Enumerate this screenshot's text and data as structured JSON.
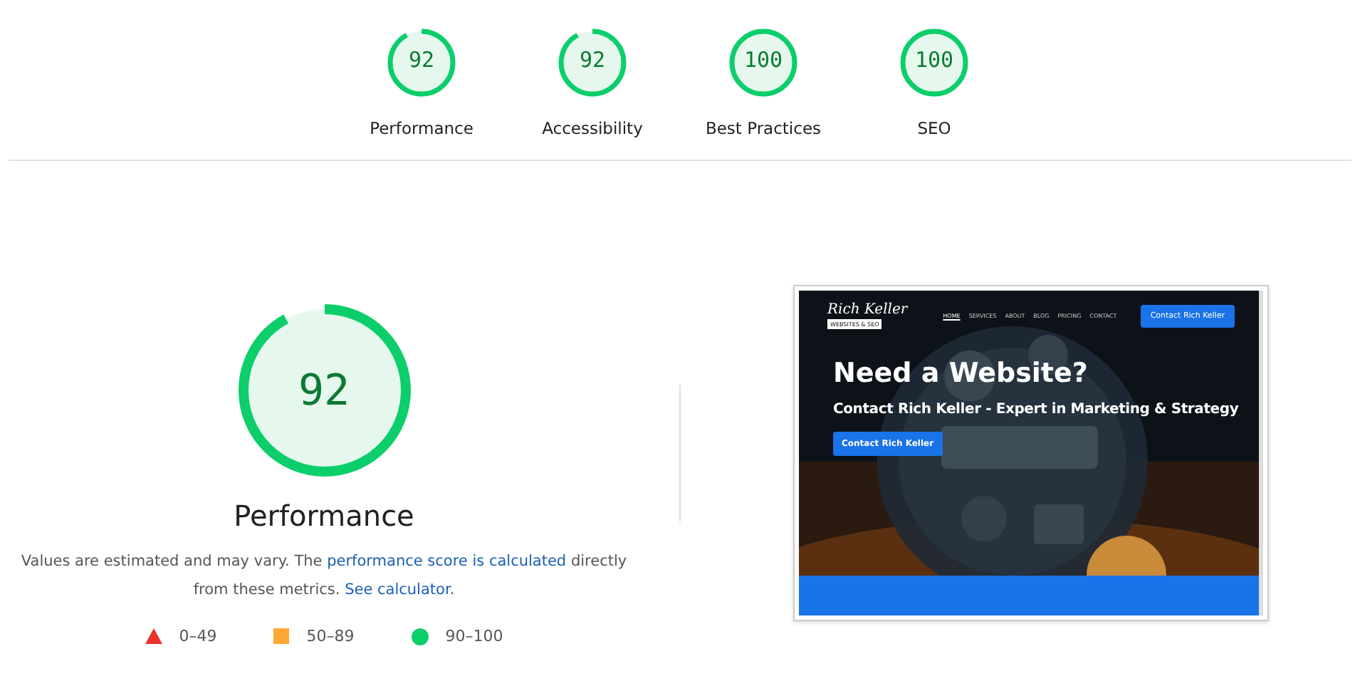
{
  "summary_gauges": [
    {
      "score": "92",
      "label": "Performance",
      "level": 0.92
    },
    {
      "score": "92",
      "label": "Accessibility",
      "level": 0.92
    },
    {
      "score": "100",
      "label": "Best Practices",
      "level": 1
    },
    {
      "score": "100",
      "label": "SEO",
      "level": 1
    }
  ],
  "main_gauge": {
    "score": "92",
    "level": 0.92,
    "title": "Performance"
  },
  "description": {
    "before": "Values are estimated and may vary. The ",
    "link_1": "performance score is calculated",
    "middle": " directly from these metrics. ",
    "link_2": "See calculator",
    "after": "."
  },
  "legend": [
    {
      "kind": "triangle",
      "color": "#e8322b",
      "range": "0–49"
    },
    {
      "kind": "square",
      "color": "#ffa733",
      "range": "50–89"
    },
    {
      "kind": "circle",
      "color": "#0cce6b",
      "range": "90–100"
    }
  ],
  "thumbnail": {
    "logo_name": "Rich Keller",
    "logo_tag": "WEBSITES & SEO",
    "nav": [
      {
        "label": "HOME",
        "selected": true
      },
      {
        "label": "SERVICES",
        "selected": false
      },
      {
        "label": "ABOUT",
        "selected": false
      },
      {
        "label": "BLOG",
        "selected": false
      },
      {
        "label": "PRICING",
        "selected": false
      },
      {
        "label": "CONTACT",
        "selected": false
      }
    ],
    "cta": "Contact Rich Keller",
    "headline": "Need a Website?",
    "subheadline": "Contact Rich Keller - Expert in Marketing & Strategy",
    "hero_button": "Contact Rich Keller"
  }
}
